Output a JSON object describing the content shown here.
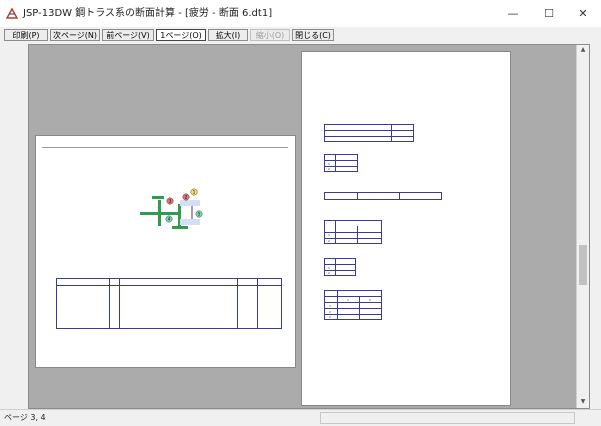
{
  "window": {
    "title": "JSP-13DW 鋼トラス系の断面計算 - [疲労 - 断面 6.dt1]",
    "minimize_glyph": "—",
    "maximize_glyph": "☐",
    "close_glyph": "✕"
  },
  "toolbar": {
    "print": "印刷(P)",
    "next_page": "次ページ(N)",
    "prev_page": "前ページ(V)",
    "one_page": "1ページ(O)",
    "zoom_in": "拡大(I)",
    "zoom_out": "縮小(O)",
    "close": "閉じる(C)"
  },
  "status": {
    "text": "ページ 3, 4"
  },
  "landscape_page": {
    "header_title": "",
    "table_headers": [
      "",
      "",
      "",
      "",
      ""
    ],
    "rows": [
      [
        "",
        "",
        "",
        "",
        ""
      ],
      [
        "",
        "",
        "",
        "",
        ""
      ],
      [
        "",
        "",
        "",
        "",
        ""
      ],
      [
        "",
        "",
        "",
        "",
        ""
      ],
      [
        "",
        "",
        "",
        "",
        ""
      ],
      [
        "",
        "",
        "",
        "",
        ""
      ]
    ],
    "footer": "",
    "diagram_markers": [
      "1",
      "2",
      "3",
      "4",
      "5"
    ]
  },
  "portrait_page": {
    "heading": "",
    "info": [
      [
        "",
        ""
      ],
      [
        "",
        ""
      ],
      [
        "",
        ""
      ],
      [
        "",
        ""
      ]
    ],
    "table1": {
      "title": "",
      "rows": [
        [
          "",
          ""
        ],
        [
          "",
          ""
        ],
        [
          "",
          ""
        ]
      ]
    },
    "table2": {
      "title": "",
      "headers": [
        "",
        ""
      ],
      "rows": [
        [
          "1",
          ""
        ],
        [
          "2",
          ""
        ]
      ]
    },
    "table3": {
      "title": "",
      "rows": [
        [
          "",
          "",
          ""
        ]
      ]
    },
    "table4": {
      "title": "",
      "headers": [
        "",
        "",
        ""
      ],
      "rows": [
        [
          "1",
          "",
          ""
        ],
        [
          "2",
          "",
          ""
        ]
      ]
    },
    "table5": {
      "title": "",
      "headers": [
        "",
        ""
      ],
      "rows": [
        [
          "1",
          ""
        ],
        [
          "2",
          ""
        ]
      ]
    },
    "table6": {
      "title": "",
      "headers": [
        "",
        "1",
        "2"
      ],
      "rows": [
        [
          "1",
          "",
          ""
        ],
        [
          "2",
          "",
          ""
        ],
        [
          "3",
          "",
          ""
        ]
      ]
    },
    "footer": ""
  }
}
